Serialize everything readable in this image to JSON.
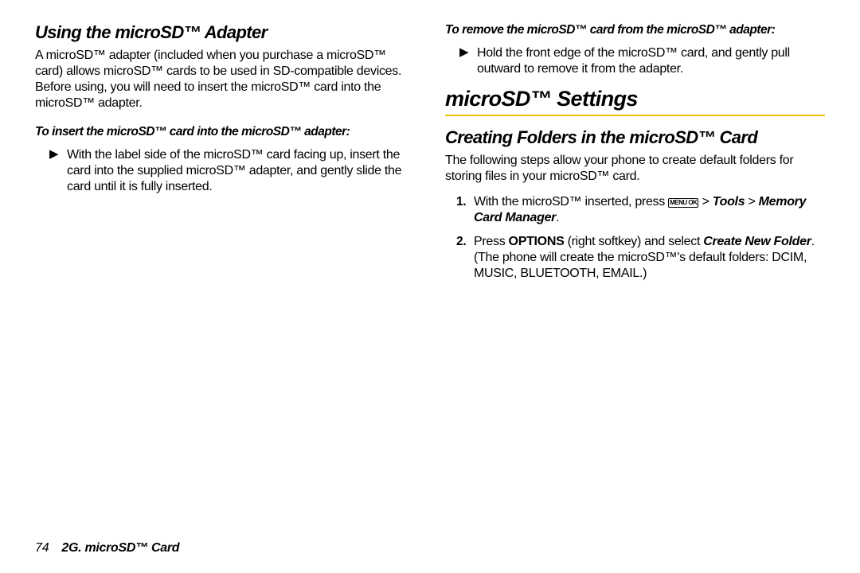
{
  "left": {
    "heading": "Using the microSD™ Adapter",
    "intro": "A microSD™ adapter (included when you purchase a microSD™ card) allows microSD™ cards to be used in SD-compatible devices. Before using, you will need to insert the microSD™ card into the microSD™ adapter.",
    "insert_title": "To insert the microSD™ card into the microSD™ adapter:",
    "insert_step": "With the label side of the microSD™ card facing up, insert the card into the supplied microSD™ adapter, and gently slide the card until it is fully inserted."
  },
  "right": {
    "remove_title": "To remove the microSD™ card from the microSD™ adapter:",
    "remove_step": "Hold the front edge of the microSD™ card, and gently pull outward to remove it from the adapter.",
    "section": "microSD™ Settings",
    "create_heading": "Creating Folders in the microSD™ Card",
    "create_intro": "The following steps allow your phone to create default folders for storing files in your microSD™ card.",
    "step1_a": "With the microSD™ inserted, press ",
    "step1_b": " > ",
    "step1_tools": "Tools",
    "step1_c": " > ",
    "step1_mgr": "Memory Card Manager",
    "step1_d": ".",
    "step2_a": "Press ",
    "step2_options": "OPTIONS",
    "step2_b": " (right softkey) and select ",
    "step2_create": "Create New Folder",
    "step2_c": ". (The phone will create the microSD™'s default folders: DCIM, MUSIC, BLUETOOTH, EMAIL.)",
    "key_label": "MENU OK"
  },
  "footer": {
    "page": "74",
    "section": "2G. microSD™ Card"
  },
  "markers": {
    "tri": "▶",
    "n1": "1.",
    "n2": "2."
  }
}
